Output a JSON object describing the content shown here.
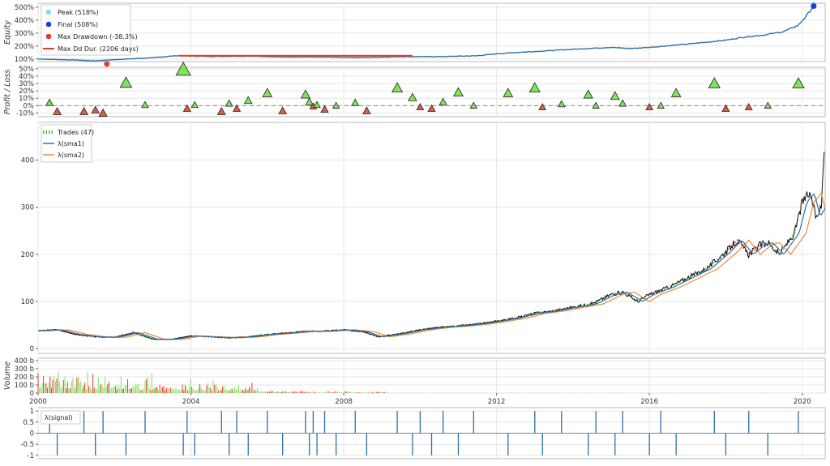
{
  "chart_data": [
    {
      "panel": "equity",
      "type": "line",
      "ylabel": "Equity",
      "yticks": [
        "100%",
        "200%",
        "300%",
        "400%",
        "500%"
      ],
      "ylim": [
        80,
        530
      ],
      "legend": [
        "Peak (518%)",
        "Final (508%)",
        "Max Drawdown (-38.3%)",
        "Max Dd Dur. (2206 days)"
      ],
      "legend_position": "top-left",
      "colors": {
        "line": "#2e6fa8",
        "peak_fill": "#f5d68a",
        "peak": "#7ee0f2",
        "final": "#1a3fdb",
        "drawdown": "#e0402a"
      },
      "equity": [
        [
          2000.0,
          100
        ],
        [
          2001.0,
          92
        ],
        [
          2001.5,
          85
        ],
        [
          2002.0,
          95
        ],
        [
          2003.0,
          110
        ],
        [
          2003.6,
          125
        ],
        [
          2004.5,
          120
        ],
        [
          2005.5,
          122
        ],
        [
          2006.5,
          115
        ],
        [
          2007.5,
          115
        ],
        [
          2008.5,
          112
        ],
        [
          2009.0,
          115
        ],
        [
          2009.5,
          118
        ],
        [
          2010.5,
          118
        ],
        [
          2011.5,
          125
        ],
        [
          2012.0,
          140
        ],
        [
          2012.5,
          150
        ],
        [
          2013.0,
          158
        ],
        [
          2014.0,
          175
        ],
        [
          2015.0,
          190
        ],
        [
          2015.5,
          180
        ],
        [
          2016.0,
          190
        ],
        [
          2017.0,
          215
        ],
        [
          2018.0,
          245
        ],
        [
          2018.5,
          270
        ],
        [
          2019.0,
          285
        ],
        [
          2019.5,
          310
        ],
        [
          2019.9,
          360
        ],
        [
          2020.1,
          430
        ],
        [
          2020.3,
          508
        ]
      ],
      "peak": {
        "x": 2020.3,
        "y": 518
      },
      "final": {
        "x": 2020.3,
        "y": 508
      },
      "max_drawdown_point": {
        "x": 2001.8,
        "y": 62
      },
      "max_dd_duration": {
        "x_start": 2003.7,
        "x_end": 2009.8,
        "y": 125
      }
    },
    {
      "panel": "trades_pnl",
      "type": "scatter",
      "ylabel": "Profit / Loss",
      "yticks": [
        "-10%",
        "0%",
        "10%",
        "20%",
        "30%",
        "40%",
        "50%"
      ],
      "ylim": [
        -15,
        52
      ],
      "colors": {
        "win": "#7fe35a",
        "loss": "#e05c3c"
      },
      "trades": [
        [
          2000.3,
          4
        ],
        [
          2000.5,
          -8
        ],
        [
          2001.2,
          -8
        ],
        [
          2001.5,
          -6
        ],
        [
          2001.7,
          -10
        ],
        [
          2002.3,
          31
        ],
        [
          2002.8,
          1
        ],
        [
          2003.8,
          49
        ],
        [
          2003.9,
          -4
        ],
        [
          2004.1,
          1
        ],
        [
          2004.8,
          -8
        ],
        [
          2005.0,
          3
        ],
        [
          2005.2,
          -4
        ],
        [
          2005.5,
          7
        ],
        [
          2006.0,
          17
        ],
        [
          2006.4,
          -7
        ],
        [
          2007.0,
          15
        ],
        [
          2007.1,
          5
        ],
        [
          2007.2,
          -1
        ],
        [
          2007.3,
          1
        ],
        [
          2007.5,
          -5
        ],
        [
          2007.8,
          0
        ],
        [
          2008.3,
          4
        ],
        [
          2008.6,
          -7
        ],
        [
          2009.4,
          24
        ],
        [
          2009.8,
          11
        ],
        [
          2010.0,
          -2
        ],
        [
          2010.3,
          -4
        ],
        [
          2010.6,
          5
        ],
        [
          2011.0,
          18
        ],
        [
          2011.4,
          0
        ],
        [
          2012.3,
          17
        ],
        [
          2013.0,
          24
        ],
        [
          2013.2,
          -2
        ],
        [
          2013.7,
          2
        ],
        [
          2014.4,
          15
        ],
        [
          2014.6,
          0
        ],
        [
          2015.1,
          13
        ],
        [
          2015.3,
          3
        ],
        [
          2016.0,
          -2
        ],
        [
          2016.3,
          0
        ],
        [
          2016.7,
          17
        ],
        [
          2017.7,
          30
        ],
        [
          2018.0,
          -4
        ],
        [
          2018.6,
          -2
        ],
        [
          2019.1,
          0
        ],
        [
          2019.9,
          30
        ]
      ]
    },
    {
      "panel": "price",
      "type": "line",
      "ylabel": "",
      "yticks": [
        "0",
        "100",
        "200",
        "300",
        "400"
      ],
      "ylim": [
        -10,
        480
      ],
      "legend": [
        "Trades (47)",
        "λ(sma1)",
        "λ(sma2)"
      ],
      "legend_position": "top-left",
      "colors": {
        "price": "#111111",
        "sma1": "#2e6fa8",
        "sma2": "#ef8a3c",
        "trade": "#3fbf2a",
        "trade_loss": "#e0402a"
      },
      "price": [
        [
          2000.0,
          38
        ],
        [
          2000.5,
          40
        ],
        [
          2001.0,
          30
        ],
        [
          2001.5,
          25
        ],
        [
          2002.0,
          24
        ],
        [
          2002.5,
          34
        ],
        [
          2003.0,
          20
        ],
        [
          2003.5,
          20
        ],
        [
          2004.0,
          27
        ],
        [
          2004.5,
          25
        ],
        [
          2005.0,
          23
        ],
        [
          2005.5,
          25
        ],
        [
          2006.0,
          30
        ],
        [
          2006.5,
          33
        ],
        [
          2007.0,
          37
        ],
        [
          2007.5,
          37
        ],
        [
          2008.0,
          40
        ],
        [
          2008.5,
          36
        ],
        [
          2008.9,
          25
        ],
        [
          2009.5,
          32
        ],
        [
          2010.0,
          40
        ],
        [
          2010.5,
          45
        ],
        [
          2011.0,
          48
        ],
        [
          2011.5,
          52
        ],
        [
          2012.0,
          58
        ],
        [
          2012.5,
          65
        ],
        [
          2013.0,
          75
        ],
        [
          2013.5,
          80
        ],
        [
          2014.0,
          88
        ],
        [
          2014.5,
          95
        ],
        [
          2015.0,
          115
        ],
        [
          2015.3,
          120
        ],
        [
          2015.5,
          110
        ],
        [
          2015.7,
          100
        ],
        [
          2016.0,
          115
        ],
        [
          2016.5,
          130
        ],
        [
          2017.0,
          150
        ],
        [
          2017.5,
          170
        ],
        [
          2018.0,
          205
        ],
        [
          2018.3,
          230
        ],
        [
          2018.6,
          200
        ],
        [
          2018.9,
          220
        ],
        [
          2019.1,
          225
        ],
        [
          2019.4,
          200
        ],
        [
          2019.8,
          245
        ],
        [
          2020.0,
          310
        ],
        [
          2020.2,
          330
        ],
        [
          2020.35,
          280
        ],
        [
          2020.5,
          300
        ],
        [
          2020.6,
          470
        ]
      ],
      "sma_lag": {
        "sma1": 0.12,
        "sma2": 0.3
      }
    },
    {
      "panel": "volume",
      "type": "bar",
      "ylabel": "Volume",
      "yticks": [
        "0",
        "100 b",
        "200 b",
        "300 b",
        "400 b"
      ],
      "ylim": [
        0,
        430
      ],
      "colors": {
        "up": "#7fe35a",
        "down": "#e0402a"
      },
      "volume_envelope": [
        [
          2000.0,
          380
        ],
        [
          2002.0,
          300
        ],
        [
          2004.0,
          200
        ],
        [
          2005.7,
          150
        ],
        [
          2005.8,
          40
        ],
        [
          2009.0,
          25
        ],
        [
          2009.2,
          3
        ],
        [
          2020.6,
          2
        ]
      ]
    },
    {
      "panel": "signal",
      "type": "bar",
      "ylabel": "",
      "yticks": [
        "-1",
        "-0.5",
        "0",
        "0.5",
        "1"
      ],
      "ylim": [
        -1.15,
        1.15
      ],
      "legend": [
        "λ(signal)"
      ],
      "legend_position": "top-left",
      "colors": {
        "bar": "#2e6fa8"
      },
      "signals": [
        [
          2000.3,
          1
        ],
        [
          2000.5,
          -1
        ],
        [
          2001.2,
          1
        ],
        [
          2001.5,
          -1
        ],
        [
          2001.7,
          1
        ],
        [
          2002.3,
          -1
        ],
        [
          2002.8,
          1
        ],
        [
          2003.8,
          -1
        ],
        [
          2003.9,
          1
        ],
        [
          2004.1,
          -1
        ],
        [
          2004.8,
          1
        ],
        [
          2005.0,
          -1
        ],
        [
          2005.2,
          1
        ],
        [
          2005.5,
          -1
        ],
        [
          2006.0,
          1
        ],
        [
          2006.4,
          -1
        ],
        [
          2007.0,
          1
        ],
        [
          2007.1,
          -1
        ],
        [
          2007.2,
          1
        ],
        [
          2007.3,
          -1
        ],
        [
          2007.5,
          1
        ],
        [
          2007.8,
          -1
        ],
        [
          2008.3,
          1
        ],
        [
          2008.6,
          -1
        ],
        [
          2009.4,
          1
        ],
        [
          2009.8,
          -1
        ],
        [
          2010.0,
          1
        ],
        [
          2010.3,
          -1
        ],
        [
          2010.6,
          1
        ],
        [
          2011.0,
          -1
        ],
        [
          2011.4,
          1
        ],
        [
          2012.3,
          -1
        ],
        [
          2013.0,
          1
        ],
        [
          2013.2,
          -1
        ],
        [
          2013.7,
          1
        ],
        [
          2014.4,
          -1
        ],
        [
          2014.6,
          1
        ],
        [
          2015.1,
          -1
        ],
        [
          2015.3,
          1
        ],
        [
          2016.0,
          -1
        ],
        [
          2016.3,
          1
        ],
        [
          2016.7,
          -1
        ],
        [
          2017.7,
          1
        ],
        [
          2018.0,
          -1
        ],
        [
          2018.6,
          1
        ],
        [
          2019.1,
          -1
        ],
        [
          2019.9,
          1
        ]
      ]
    }
  ],
  "x_axis": {
    "xlim": [
      2000,
      2020.6
    ],
    "ticks": [
      "2000",
      "2004",
      "2008",
      "2012",
      "2016",
      "2020"
    ]
  }
}
